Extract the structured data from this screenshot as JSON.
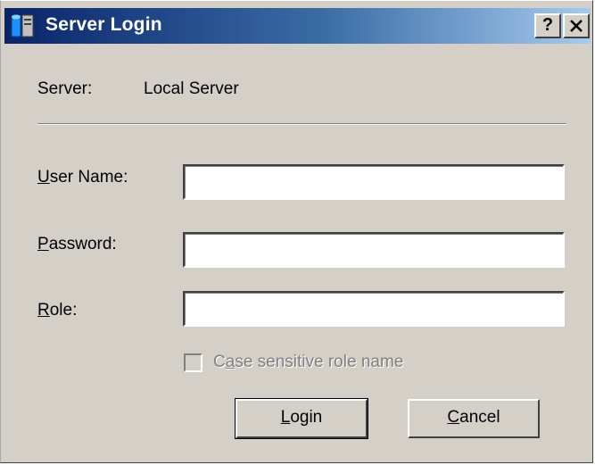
{
  "window": {
    "title": "Server Login",
    "help_button": "?",
    "close_button": "✕",
    "title_gradient": [
      "#0a246a",
      "#a6caf0"
    ]
  },
  "server": {
    "label": "Server:",
    "value": "Local Server"
  },
  "fields": {
    "user_name": {
      "label_accel": "U",
      "label_rest": "ser Name:",
      "value": ""
    },
    "password": {
      "label_accel": "P",
      "label_rest": "assword:",
      "value": ""
    },
    "role": {
      "label_accel": "R",
      "label_rest": "ole:",
      "value": ""
    }
  },
  "case_sensitive": {
    "label_pre": "C",
    "label_accel": "a",
    "label_rest": "se sensitive role name",
    "checked": false,
    "enabled": false
  },
  "buttons": {
    "login": {
      "label_accel": "L",
      "label_rest": "ogin"
    },
    "cancel": {
      "label_accel": "C",
      "label_rest": "ancel"
    }
  }
}
